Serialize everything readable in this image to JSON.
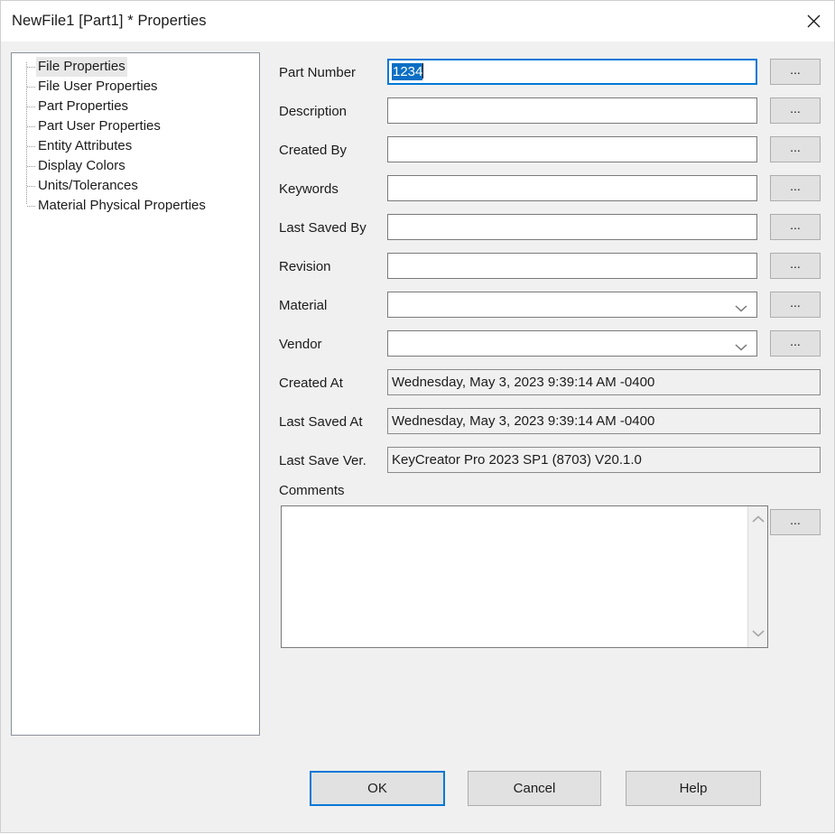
{
  "window": {
    "title": "NewFile1 [Part1] * Properties",
    "close_icon": "close-icon",
    "accent_color": "#0078d7",
    "dialog_bg": "#f0f0f0",
    "titlebar_bg": "#ffffff"
  },
  "tree": {
    "selected": "File Properties",
    "items": [
      {
        "label": "File Properties"
      },
      {
        "label": "File User Properties"
      },
      {
        "label": "Part Properties"
      },
      {
        "label": "Part User Properties"
      },
      {
        "label": "Entity Attributes"
      },
      {
        "label": "Display Colors"
      },
      {
        "label": "Units/Tolerances"
      },
      {
        "label": "Material Physical Properties"
      }
    ]
  },
  "form": {
    "browse_label": "...",
    "fields": [
      {
        "label": "Part Number",
        "type": "text",
        "value": "1234",
        "selected_text": "1234",
        "focused": true,
        "has_browse": true
      },
      {
        "label": "Description",
        "type": "text",
        "value": "",
        "focused": false,
        "has_browse": true
      },
      {
        "label": "Created By",
        "type": "text",
        "value": "",
        "focused": false,
        "has_browse": true
      },
      {
        "label": "Keywords",
        "type": "text",
        "value": "",
        "focused": false,
        "has_browse": true
      },
      {
        "label": "Last Saved By",
        "type": "text",
        "value": "",
        "focused": false,
        "has_browse": true
      },
      {
        "label": "Revision",
        "type": "text",
        "value": "",
        "focused": false,
        "has_browse": true
      },
      {
        "label": "Material",
        "type": "combo",
        "value": "",
        "focused": false,
        "has_browse": true
      },
      {
        "label": "Vendor",
        "type": "combo",
        "value": "",
        "focused": false,
        "has_browse": true
      },
      {
        "label": "Created At",
        "type": "readonly",
        "value": "Wednesday, May 3, 2023 9:39:14 AM -0400",
        "has_browse": false
      },
      {
        "label": "Last Saved At",
        "type": "readonly",
        "value": "Wednesday, May 3, 2023 9:39:14 AM -0400",
        "has_browse": false
      },
      {
        "label": "Last Save Ver.",
        "type": "readonly",
        "value": "KeyCreator Pro 2023 SP1 (8703) V20.1.0",
        "has_browse": false
      }
    ],
    "comments": {
      "label": "Comments",
      "value": "",
      "browse_label": "...",
      "scroll_up_icon": "chevron-up-icon",
      "scroll_down_icon": "chevron-down-icon"
    }
  },
  "buttons": {
    "ok": "OK",
    "cancel": "Cancel",
    "help": "Help",
    "default": "OK"
  }
}
